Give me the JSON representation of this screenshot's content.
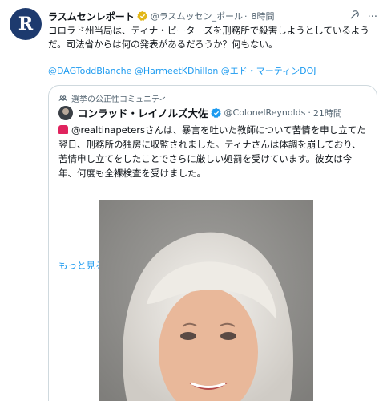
{
  "tweet": {
    "avatar_letter": "R",
    "author_name": "ラスムセンレポート",
    "handle": "@ラスムッセン_ポール",
    "separator": "·",
    "time": "8時間",
    "text": "コロラド州当局は、ティナ・ピーターズを刑務所で殺害しようとしているようだ。司法省からは何の発表があるだろうか？何もない。",
    "mentions": "@DAGToddBlanche @HarmeetKDhillon @エド・マーティンDOJ",
    "more_menu": "···"
  },
  "quote": {
    "community": "選挙の公正性コミュニティ",
    "author_name": "コンラッド・レイノルズ大佐",
    "handle": "@ColonelReynolds",
    "separator": "·",
    "time": "21時間",
    "text": "@realtinapetersさんは、暴言を吐いた教師について苦情を申し立てた翌日、刑務所の独房に収監されました。ティナさんは体調を崩しており、苦情申し立てをしたことでさらに厳しい処罰を受けています。彼女は今年、何度も全裸検査を受けました。",
    "show_more": "もっと見る"
  },
  "colors": {
    "accent": "#1d9bf0",
    "muted": "#536471",
    "text": "#0f1419",
    "border": "#cfd9de",
    "gold": "#e2b719"
  }
}
